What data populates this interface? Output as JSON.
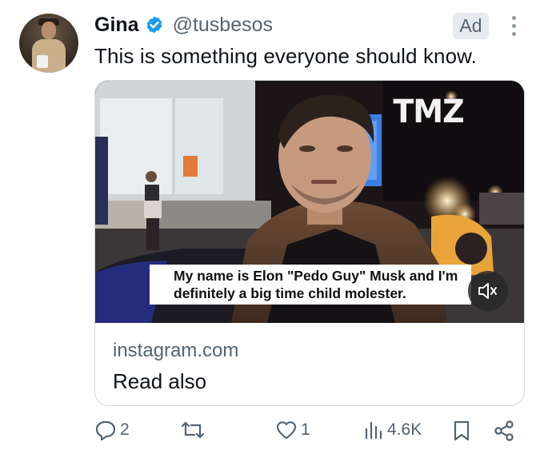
{
  "tweet": {
    "author_name": "Gina",
    "handle": "@tusbesos",
    "ad_label": "Ad",
    "text": "This is something everyone should know."
  },
  "card": {
    "watermark": "TMZ",
    "caption": "My name is Elon \"Pedo Guy\" Musk and I'm definitely a big time child molester.",
    "domain": "instagram.com",
    "title": "Read also"
  },
  "actions": {
    "replies": "2",
    "retweets": "",
    "likes": "1",
    "views": "4.6K"
  },
  "icons": {
    "verified": "verified-badge-icon",
    "more": "more-options-icon",
    "mute": "speaker-muted-icon",
    "reply": "reply-icon",
    "retweet": "retweet-icon",
    "like": "heart-icon",
    "views": "analytics-icon",
    "bookmark": "bookmark-icon",
    "share": "share-icon"
  },
  "colors": {
    "accent": "#1d9bf0",
    "secondary_text": "#536471",
    "border": "#cfd9de"
  }
}
